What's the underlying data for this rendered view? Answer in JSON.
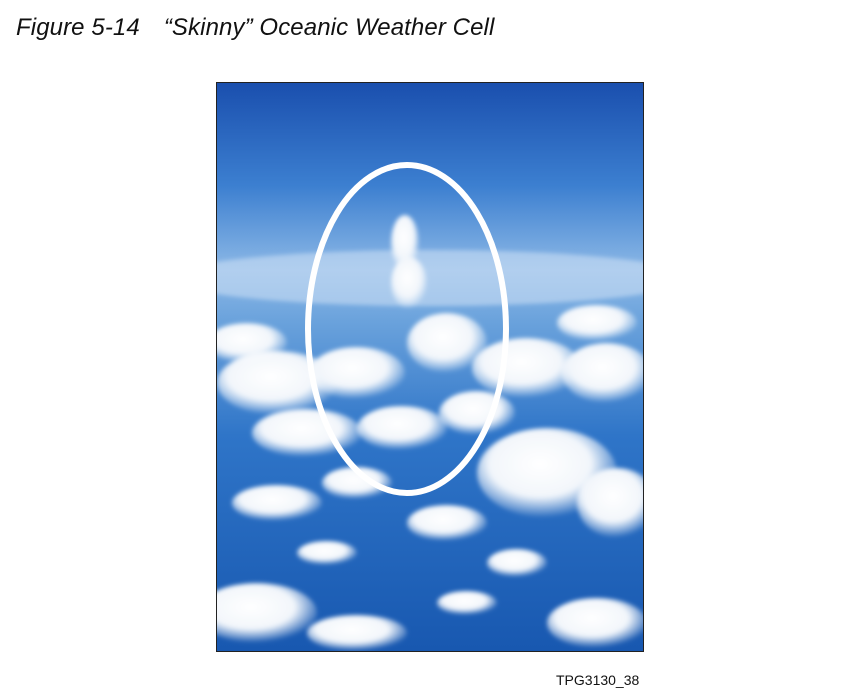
{
  "figure": {
    "number": "Figure 5-14",
    "title": "“Skinny” Oceanic Weather Cell",
    "code": "TPG3130_38"
  },
  "photo": {
    "subject": "aerial view of ocean cumulus field with a tall narrow storm cell",
    "highlight_icon": "ellipse-outline",
    "colors": {
      "sky_top": "#1e57b4",
      "sky_mid": "#5d96d6",
      "ocean": "#1b62b8",
      "cloud": "#ffffff",
      "highlight": "#ffffff"
    }
  }
}
